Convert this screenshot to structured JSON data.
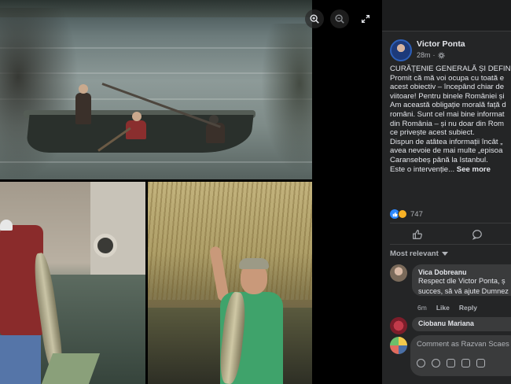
{
  "viewer": {
    "controls": [
      "zoom-in",
      "zoom-out",
      "fullscreen"
    ]
  },
  "post": {
    "author": "Victor Ponta",
    "time": "28m",
    "privacy_icon": "gear-icon",
    "text_lines": [
      "CURĂȚENIE GENERALĂ ȘI DEFINITIV",
      "Promit că mă voi ocupa cu toată e",
      "acest obiectiv – începând chiar de",
      "viitoare! Pentru binele României și",
      "Am această obligație morală față d",
      "români. Sunt cel mai bine informat",
      "din România – și nu doar din Rom",
      "ce privește acest subiect.",
      "Dispun de atâtea informații încât „",
      "avea nevoie de mai multe „episoa",
      "Caransebeș până la Istanbul.",
      "Este o intervenție..."
    ],
    "see_more": "See more",
    "reaction_count": "747",
    "reaction_colors": {
      "like": "#2d88ff",
      "haha": "#f7b125"
    }
  },
  "actions": [
    "like-icon",
    "comment-icon",
    "share-icon"
  ],
  "comments_header": "Most relevant",
  "comments": [
    {
      "name": "Vica Dobreanu",
      "lines": [
        "Respect dle Victor Ponta, ș",
        "succes, să vă ajute Dumnez"
      ],
      "time": "6m",
      "like": "Like",
      "reply": "Reply"
    },
    {
      "name": "Ciobanu Mariana",
      "lines": []
    }
  ],
  "composer": {
    "placeholder": "Comment as Razvan Scaes"
  }
}
